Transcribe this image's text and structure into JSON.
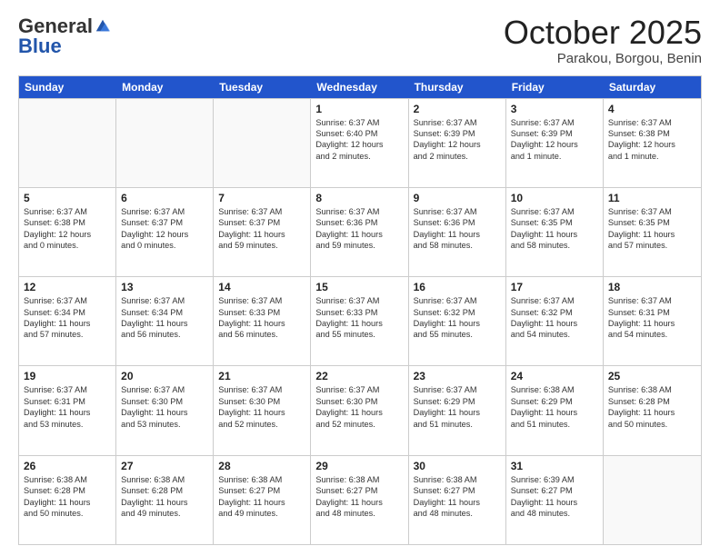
{
  "header": {
    "logo_general": "General",
    "logo_blue": "Blue",
    "month": "October 2025",
    "location": "Parakou, Borgou, Benin"
  },
  "days": [
    "Sunday",
    "Monday",
    "Tuesday",
    "Wednesday",
    "Thursday",
    "Friday",
    "Saturday"
  ],
  "rows": [
    [
      {
        "num": "",
        "lines": [],
        "empty": true
      },
      {
        "num": "",
        "lines": [],
        "empty": true
      },
      {
        "num": "",
        "lines": [],
        "empty": true
      },
      {
        "num": "1",
        "lines": [
          "Sunrise: 6:37 AM",
          "Sunset: 6:40 PM",
          "Daylight: 12 hours",
          "and 2 minutes."
        ],
        "empty": false
      },
      {
        "num": "2",
        "lines": [
          "Sunrise: 6:37 AM",
          "Sunset: 6:39 PM",
          "Daylight: 12 hours",
          "and 2 minutes."
        ],
        "empty": false
      },
      {
        "num": "3",
        "lines": [
          "Sunrise: 6:37 AM",
          "Sunset: 6:39 PM",
          "Daylight: 12 hours",
          "and 1 minute."
        ],
        "empty": false
      },
      {
        "num": "4",
        "lines": [
          "Sunrise: 6:37 AM",
          "Sunset: 6:38 PM",
          "Daylight: 12 hours",
          "and 1 minute."
        ],
        "empty": false
      }
    ],
    [
      {
        "num": "5",
        "lines": [
          "Sunrise: 6:37 AM",
          "Sunset: 6:38 PM",
          "Daylight: 12 hours",
          "and 0 minutes."
        ],
        "empty": false
      },
      {
        "num": "6",
        "lines": [
          "Sunrise: 6:37 AM",
          "Sunset: 6:37 PM",
          "Daylight: 12 hours",
          "and 0 minutes."
        ],
        "empty": false
      },
      {
        "num": "7",
        "lines": [
          "Sunrise: 6:37 AM",
          "Sunset: 6:37 PM",
          "Daylight: 11 hours",
          "and 59 minutes."
        ],
        "empty": false
      },
      {
        "num": "8",
        "lines": [
          "Sunrise: 6:37 AM",
          "Sunset: 6:36 PM",
          "Daylight: 11 hours",
          "and 59 minutes."
        ],
        "empty": false
      },
      {
        "num": "9",
        "lines": [
          "Sunrise: 6:37 AM",
          "Sunset: 6:36 PM",
          "Daylight: 11 hours",
          "and 58 minutes."
        ],
        "empty": false
      },
      {
        "num": "10",
        "lines": [
          "Sunrise: 6:37 AM",
          "Sunset: 6:35 PM",
          "Daylight: 11 hours",
          "and 58 minutes."
        ],
        "empty": false
      },
      {
        "num": "11",
        "lines": [
          "Sunrise: 6:37 AM",
          "Sunset: 6:35 PM",
          "Daylight: 11 hours",
          "and 57 minutes."
        ],
        "empty": false
      }
    ],
    [
      {
        "num": "12",
        "lines": [
          "Sunrise: 6:37 AM",
          "Sunset: 6:34 PM",
          "Daylight: 11 hours",
          "and 57 minutes."
        ],
        "empty": false
      },
      {
        "num": "13",
        "lines": [
          "Sunrise: 6:37 AM",
          "Sunset: 6:34 PM",
          "Daylight: 11 hours",
          "and 56 minutes."
        ],
        "empty": false
      },
      {
        "num": "14",
        "lines": [
          "Sunrise: 6:37 AM",
          "Sunset: 6:33 PM",
          "Daylight: 11 hours",
          "and 56 minutes."
        ],
        "empty": false
      },
      {
        "num": "15",
        "lines": [
          "Sunrise: 6:37 AM",
          "Sunset: 6:33 PM",
          "Daylight: 11 hours",
          "and 55 minutes."
        ],
        "empty": false
      },
      {
        "num": "16",
        "lines": [
          "Sunrise: 6:37 AM",
          "Sunset: 6:32 PM",
          "Daylight: 11 hours",
          "and 55 minutes."
        ],
        "empty": false
      },
      {
        "num": "17",
        "lines": [
          "Sunrise: 6:37 AM",
          "Sunset: 6:32 PM",
          "Daylight: 11 hours",
          "and 54 minutes."
        ],
        "empty": false
      },
      {
        "num": "18",
        "lines": [
          "Sunrise: 6:37 AM",
          "Sunset: 6:31 PM",
          "Daylight: 11 hours",
          "and 54 minutes."
        ],
        "empty": false
      }
    ],
    [
      {
        "num": "19",
        "lines": [
          "Sunrise: 6:37 AM",
          "Sunset: 6:31 PM",
          "Daylight: 11 hours",
          "and 53 minutes."
        ],
        "empty": false
      },
      {
        "num": "20",
        "lines": [
          "Sunrise: 6:37 AM",
          "Sunset: 6:30 PM",
          "Daylight: 11 hours",
          "and 53 minutes."
        ],
        "empty": false
      },
      {
        "num": "21",
        "lines": [
          "Sunrise: 6:37 AM",
          "Sunset: 6:30 PM",
          "Daylight: 11 hours",
          "and 52 minutes."
        ],
        "empty": false
      },
      {
        "num": "22",
        "lines": [
          "Sunrise: 6:37 AM",
          "Sunset: 6:30 PM",
          "Daylight: 11 hours",
          "and 52 minutes."
        ],
        "empty": false
      },
      {
        "num": "23",
        "lines": [
          "Sunrise: 6:37 AM",
          "Sunset: 6:29 PM",
          "Daylight: 11 hours",
          "and 51 minutes."
        ],
        "empty": false
      },
      {
        "num": "24",
        "lines": [
          "Sunrise: 6:38 AM",
          "Sunset: 6:29 PM",
          "Daylight: 11 hours",
          "and 51 minutes."
        ],
        "empty": false
      },
      {
        "num": "25",
        "lines": [
          "Sunrise: 6:38 AM",
          "Sunset: 6:28 PM",
          "Daylight: 11 hours",
          "and 50 minutes."
        ],
        "empty": false
      }
    ],
    [
      {
        "num": "26",
        "lines": [
          "Sunrise: 6:38 AM",
          "Sunset: 6:28 PM",
          "Daylight: 11 hours",
          "and 50 minutes."
        ],
        "empty": false
      },
      {
        "num": "27",
        "lines": [
          "Sunrise: 6:38 AM",
          "Sunset: 6:28 PM",
          "Daylight: 11 hours",
          "and 49 minutes."
        ],
        "empty": false
      },
      {
        "num": "28",
        "lines": [
          "Sunrise: 6:38 AM",
          "Sunset: 6:27 PM",
          "Daylight: 11 hours",
          "and 49 minutes."
        ],
        "empty": false
      },
      {
        "num": "29",
        "lines": [
          "Sunrise: 6:38 AM",
          "Sunset: 6:27 PM",
          "Daylight: 11 hours",
          "and 48 minutes."
        ],
        "empty": false
      },
      {
        "num": "30",
        "lines": [
          "Sunrise: 6:38 AM",
          "Sunset: 6:27 PM",
          "Daylight: 11 hours",
          "and 48 minutes."
        ],
        "empty": false
      },
      {
        "num": "31",
        "lines": [
          "Sunrise: 6:39 AM",
          "Sunset: 6:27 PM",
          "Daylight: 11 hours",
          "and 48 minutes."
        ],
        "empty": false
      },
      {
        "num": "",
        "lines": [],
        "empty": true
      }
    ]
  ]
}
